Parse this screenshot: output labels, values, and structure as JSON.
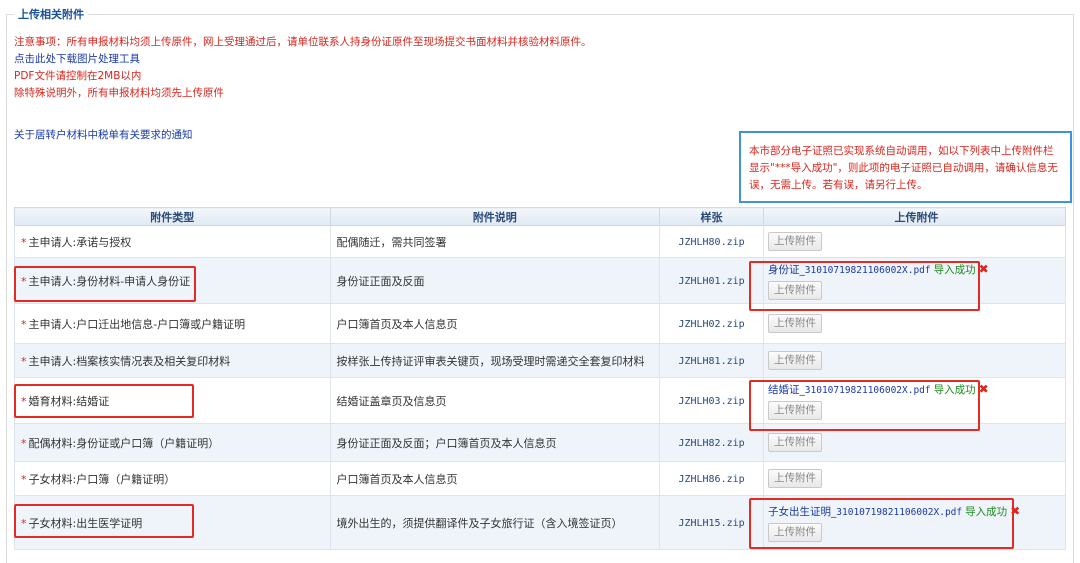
{
  "section": {
    "title": "上传相关附件"
  },
  "notes": {
    "notice": "注意事项：所有申报材料均须上传原件，网上受理通过后，请单位联系人持身份证原件至现场提交书面材料并核验材料原件。",
    "download_tool": "点击此处下载图片处理工具",
    "pdf_limit": "PDF文件请控制在2MB以内",
    "original_rule": "除特殊说明外，所有申报材料均须先上传原件",
    "tax_notice_link": "关于居转户材料中税单有关要求的通知"
  },
  "info_box": {
    "text": "本市部分电子证照已实现系统自动调用，如以下列表中上传附件栏显示\"***导入成功\"，则此项的电子证照已自动调用，请确认信息无误，无需上传。若有误，请另行上传。"
  },
  "table": {
    "headers": {
      "type": "附件类型",
      "desc": "附件说明",
      "sample": "样张",
      "upload": "上传附件"
    },
    "upload_label": "上传附件",
    "success_label": "导入成功",
    "delete_icon": "✖",
    "required_mark": "*",
    "rows": [
      {
        "type": "主申请人:承诺与授权",
        "desc": "配偶随迁，需共同签署",
        "sample": "JZHLH80.zip",
        "file_prefix": "",
        "file_code": ""
      },
      {
        "type": "主申请人:身份材料-申请人身份证",
        "desc": "身份证正面及反面",
        "sample": "JZHLH01.zip",
        "file_prefix": "身份证_",
        "file_code": "31010719821106002X.pdf"
      },
      {
        "type": "主申请人:户口迁出地信息-户口簿或户籍证明",
        "desc": "户口簿首页及本人信息页",
        "sample": "JZHLH02.zip",
        "file_prefix": "",
        "file_code": ""
      },
      {
        "type": "主申请人:档案核实情况表及相关复印材料",
        "desc": "按样张上传持证评审表关键页，现场受理时需递交全套复印材料",
        "sample": "JZHLH81.zip",
        "file_prefix": "",
        "file_code": ""
      },
      {
        "type": "婚育材料:结婚证",
        "desc": "结婚证盖章页及信息页",
        "sample": "JZHLH03.zip",
        "file_prefix": "结婚证_",
        "file_code": "31010719821106002X.pdf"
      },
      {
        "type": "配偶材料:身份证或户口簿（户籍证明）",
        "desc": "身份证正面及反面；户口簿首页及本人信息页",
        "sample": "JZHLH82.zip",
        "file_prefix": "",
        "file_code": ""
      },
      {
        "type": "子女材料:户口簿（户籍证明）",
        "desc": "户口簿首页及本人信息页",
        "sample": "JZHLH86.zip",
        "file_prefix": "",
        "file_code": ""
      },
      {
        "type": "子女材料:出生医学证明",
        "desc": "境外出生的，须提供翻译件及子女旅行证（含入境签证页）",
        "sample": "JZHLH15.zip",
        "file_prefix": "子女出生证明_",
        "file_code": "31010719821106002X.pdf"
      }
    ]
  },
  "colors": {
    "accent_red": "#e32b24",
    "notice_red": "#d9251d",
    "link_blue": "#1a3aa8",
    "success_green": "#1f8a1f",
    "info_border": "#3e93e0"
  }
}
